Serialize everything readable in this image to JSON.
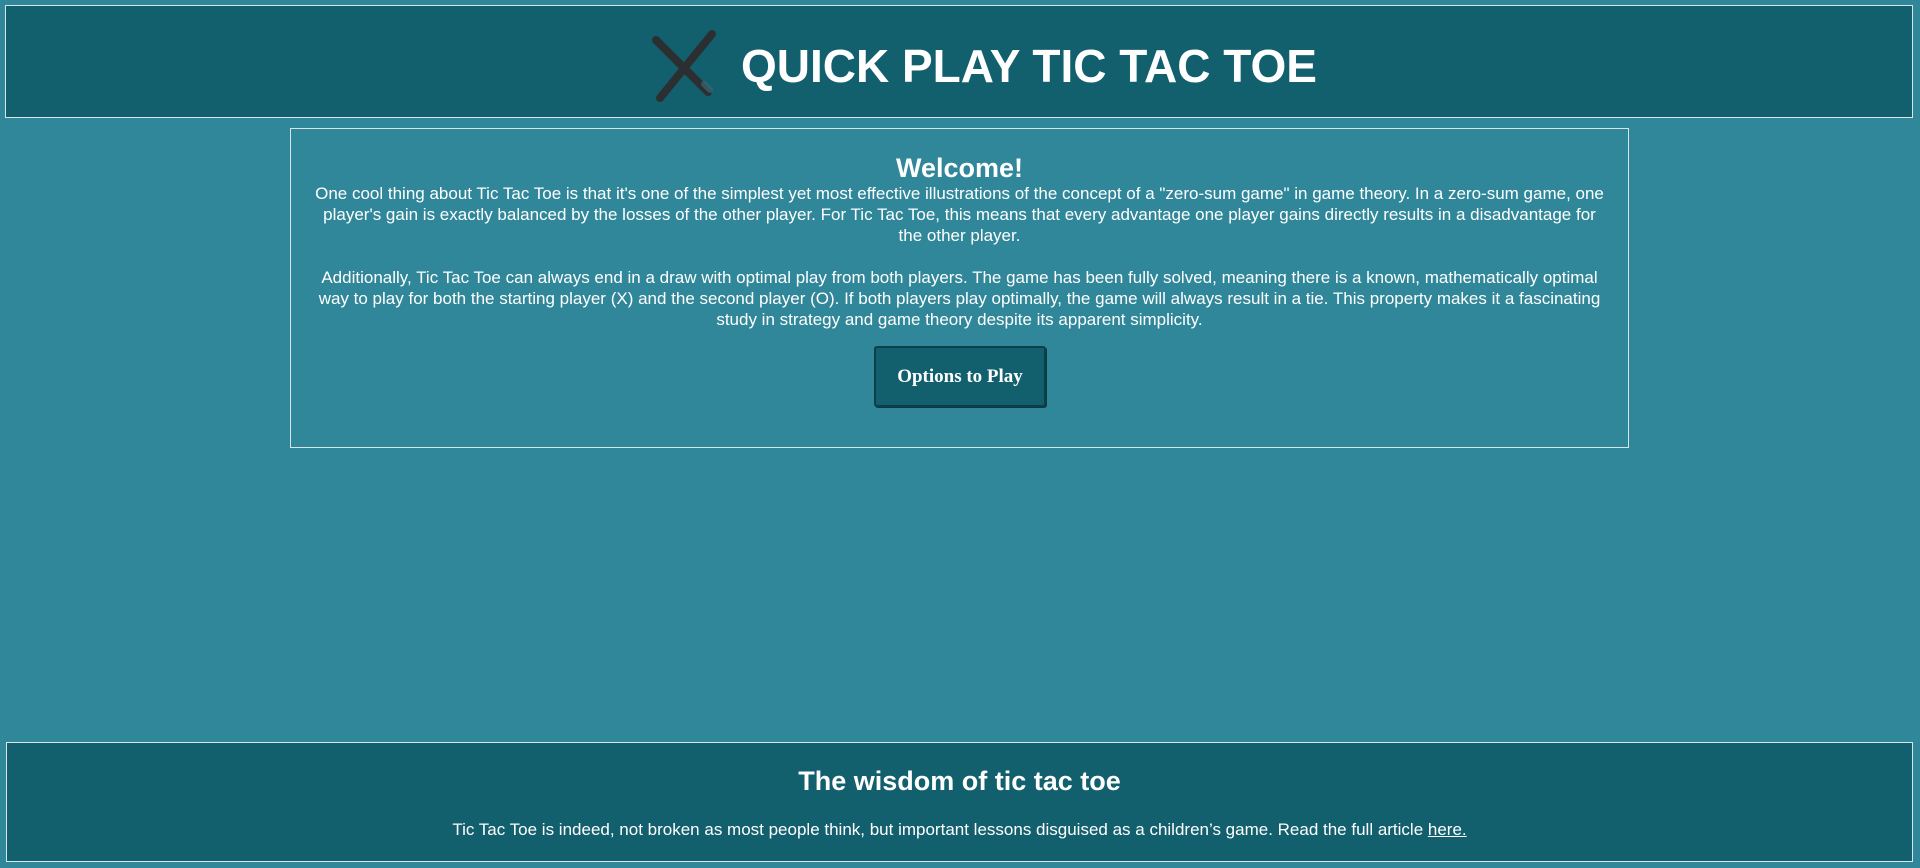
{
  "header": {
    "title": "QUICK PLAY TIC TAC TOE",
    "logo_icon": "x-mark-icon"
  },
  "welcome": {
    "title": "Welcome!",
    "paragraph1": "One cool thing about Tic Tac Toe is that it's one of the simplest yet most effective illustrations of the concept of a \"zero-sum game\" in game theory. In a zero-sum game, one player's gain is exactly balanced by the losses of the other player. For Tic Tac Toe, this means that every advantage one player gains directly results in a disadvantage for the other player.",
    "paragraph2": "Additionally, Tic Tac Toe can always end in a draw with optimal play from both players. The game has been fully solved, meaning there is a known, mathematically optimal way to play for both the starting player (X) and the second player (O). If both players play optimally, the game will always result in a tie. This property makes it a fascinating study in strategy and game theory despite its apparent simplicity.",
    "button_label": "Options to Play"
  },
  "footer": {
    "title": "The wisdom of tic tac toe",
    "text": "Tic Tac Toe is indeed, not broken as most people think, but important lessons disguised as a children’s game. Read the full article ",
    "link_label": "here."
  },
  "colors": {
    "page_background": "#2f8799",
    "panel_dark": "#125f6d",
    "border": "#d9e6e9",
    "text": "#ffffff"
  }
}
